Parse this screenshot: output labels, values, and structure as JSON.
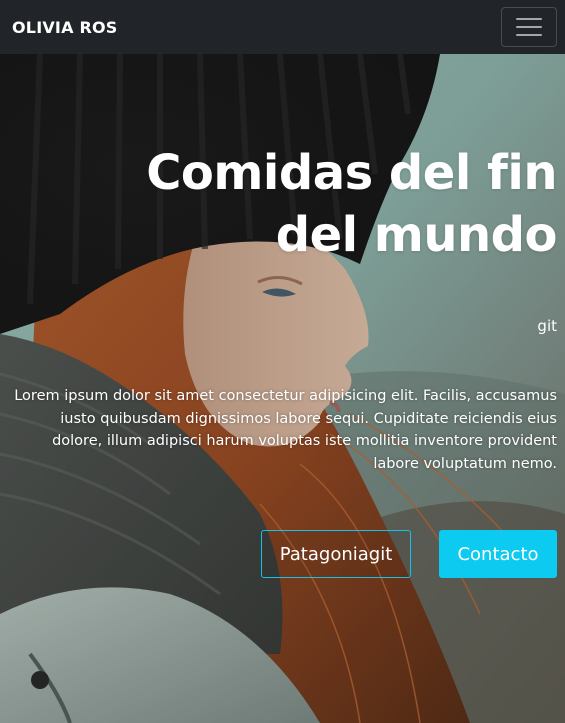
{
  "navbar": {
    "brand": "OLIVIA ROS",
    "toggle_icon": "hamburger-menu-icon"
  },
  "hero": {
    "title": "Comidas del fin del mundo",
    "subtitle": "git",
    "text": "Lorem ipsum dolor sit amet consectetur adipisicing elit. Facilis, accusamus iusto quibusdam dignissimos labore sequi. Cupiditate reiciendis eius dolore, illum adipisci harum voluptas iste mollitia inventore provident labore voluptatum nemo.",
    "buttons": {
      "secondary_label": "Patagoniagit",
      "primary_label": "Contacto"
    }
  },
  "colors": {
    "navbar_bg": "#212529",
    "accent": "#0dcaf0",
    "text": "#ffffff"
  }
}
